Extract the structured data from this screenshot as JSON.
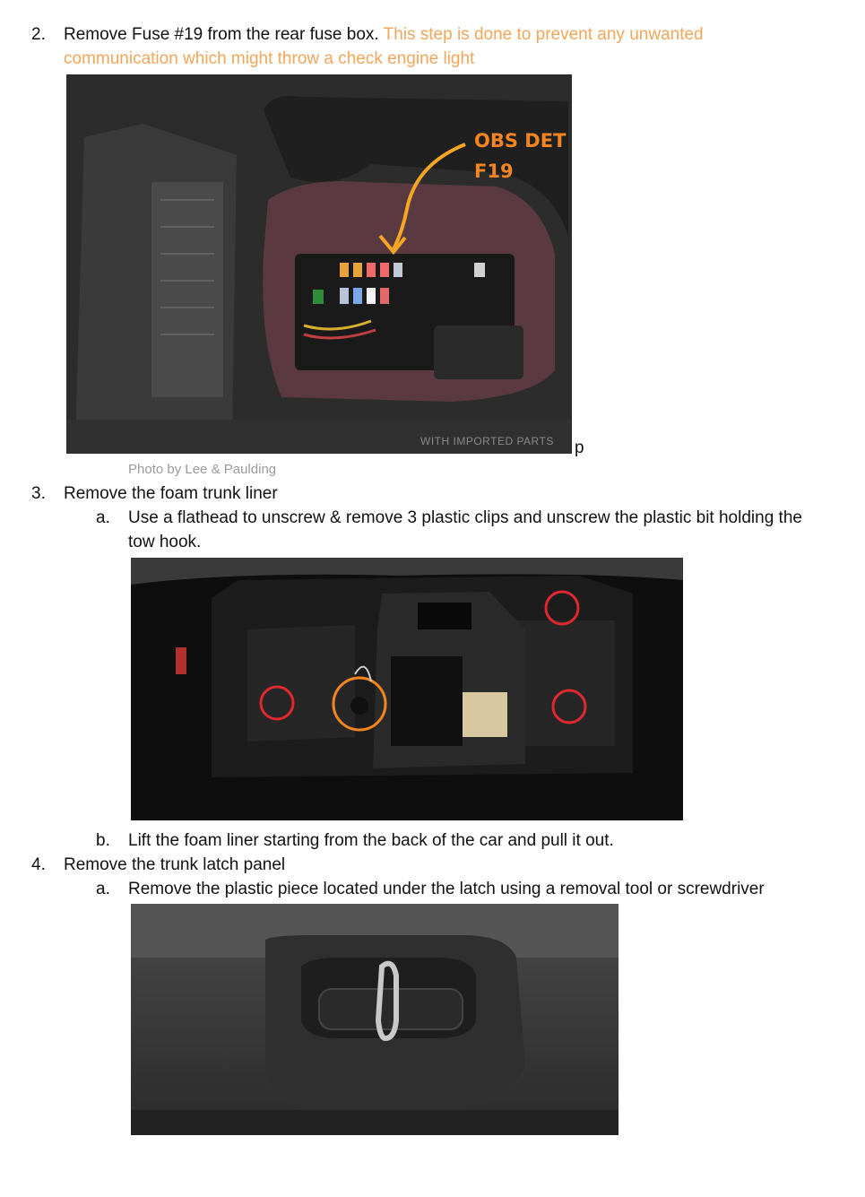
{
  "steps": [
    {
      "number": "2.",
      "text": "Remove Fuse #19 from the rear fuse box.",
      "note_line1": "This step is done to prevent any unwanted",
      "note_line2": "communication which might throw a check engine light"
    },
    {
      "number": "3.",
      "text": "Remove the foam trunk liner",
      "substeps": [
        {
          "letter": "a.",
          "line1": "Use a flathead to unscrew & remove 3 plastic clips and unscrew the plastic bit holding the",
          "line2": "tow hook."
        },
        {
          "letter": "b.",
          "line1": "Lift the foam liner starting from the back of the car and pull it out."
        }
      ]
    },
    {
      "number": "4.",
      "text": "Remove the trunk latch panel",
      "substeps": [
        {
          "letter": "a.",
          "line1": "Remove the plastic piece located under the latch using a removal tool or screwdriver"
        }
      ]
    }
  ],
  "photo1": {
    "label_line1": "OBS DET",
    "label_line2": "F19",
    "stamp_text": "WITH IMPORTED PARTS",
    "trailing_char": "p",
    "caption": "Photo by Lee & Paulding"
  },
  "colors": {
    "note_orange": "#f2a65a",
    "annotation_orange": "#f5851f",
    "circle_red": "#e0282e",
    "caption_gray": "#9a9a9a"
  }
}
